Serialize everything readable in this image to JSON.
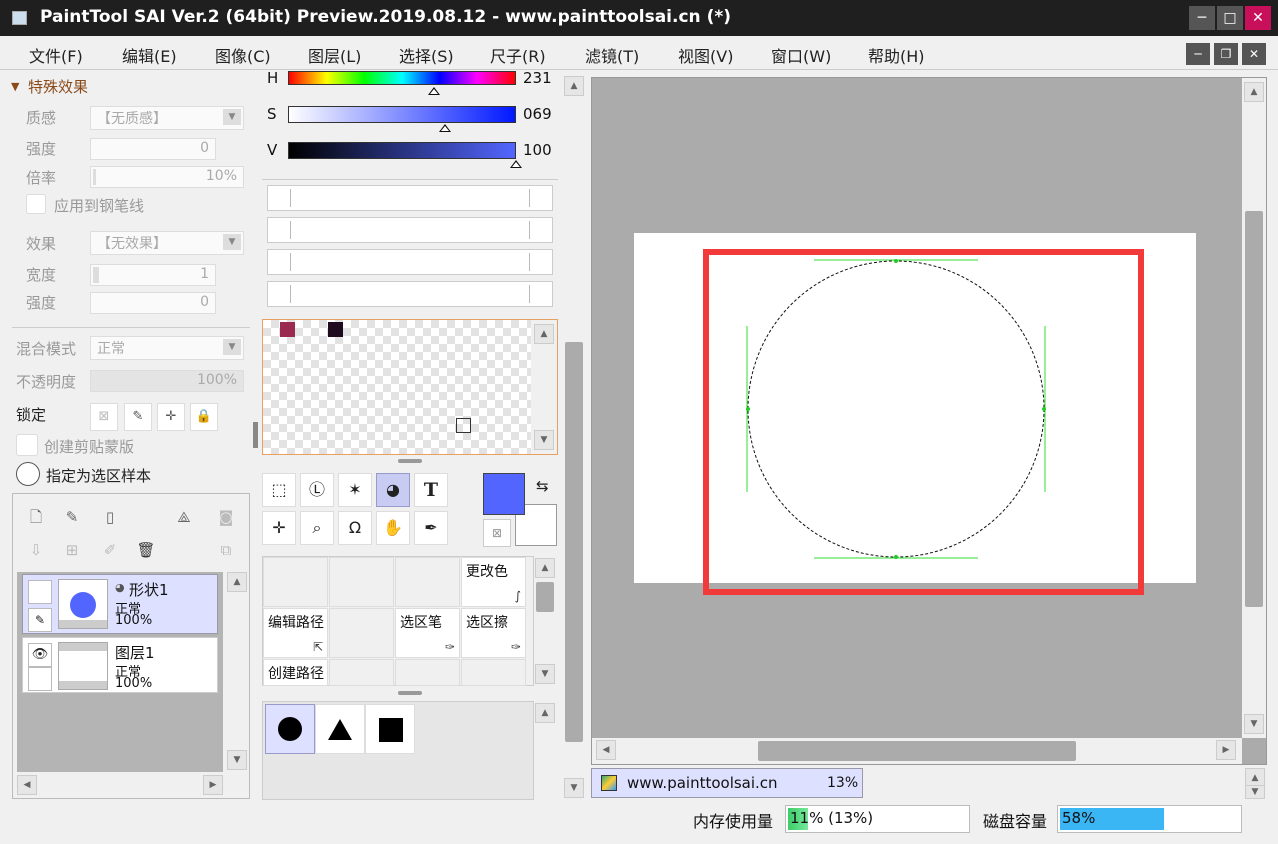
{
  "window": {
    "title": "PaintTool SAI Ver.2 (64bit) Preview.2019.08.12 - www.painttoolsai.cn (*)",
    "min_glyph": "─",
    "max_glyph": "□",
    "close_glyph": "✕",
    "mdi_min_glyph": "─",
    "mdi_restore_glyph": "❐",
    "mdi_close_glyph": "✕"
  },
  "menu": [
    "文件(F)",
    "编辑(E)",
    "图像(C)",
    "图层(L)",
    "选择(S)",
    "尺子(R)",
    "滤镜(T)",
    "视图(V)",
    "窗口(W)",
    "帮助(H)"
  ],
  "effects": {
    "section_title": "特殊效果",
    "texture_label": "质感",
    "texture_value": "【无质感】",
    "strength_label": "强度",
    "strength_value": "0",
    "scale_label": "倍率",
    "scale_value": "10%",
    "apply_pen_label": "应用到钢笔线",
    "effect_label": "效果",
    "effect_value": "【无效果】",
    "width_label": "宽度",
    "width_value": "1",
    "strength2_label": "强度",
    "strength2_value": "0"
  },
  "layer_props": {
    "blend_label": "混合模式",
    "blend_value": "正常",
    "opacity_label": "不透明度",
    "opacity_value": "100%",
    "lock_label": "锁定",
    "clip_label": "创建剪贴蒙版",
    "sample_label": "指定为选区样本"
  },
  "layers": [
    {
      "name": "形状1",
      "mode": "正常",
      "opacity": "100%",
      "selected": true
    },
    {
      "name": "图层1",
      "mode": "正常",
      "opacity": "100%",
      "selected": false
    }
  ],
  "color": {
    "h_label": "H",
    "h_value": "231",
    "h_level": 0.64,
    "s_label": "S",
    "s_value": "069",
    "s_level": 0.69,
    "v_label": "V",
    "v_value": "100",
    "v_level": 1.0,
    "foreground": "#5266ff",
    "background": "#ffffff",
    "swatches": [
      "#9a2a4f",
      "#200a1e"
    ]
  },
  "tools": [
    "rect-select",
    "lasso",
    "magic-wand",
    "shape",
    "text",
    "move",
    "zoom",
    "rotate",
    "hand",
    "eyedropper"
  ],
  "tool_glyphs": {
    "rect": "⬚",
    "lasso": "Ⓛ",
    "wand": "✶",
    "shape": "◕",
    "text": "T",
    "move": "✛",
    "zoom": "⌕",
    "rotate": "Ω",
    "hand": "✋",
    "dropper": "✒"
  },
  "tool_grid": {
    "change_color": "更改色",
    "edit_path": "编辑路径",
    "select_pen": "选区笔",
    "select_erase": "选区擦",
    "create_path": "创建路径"
  },
  "document": {
    "name": "www.painttoolsai.cn",
    "zoom": "13%"
  },
  "status": {
    "memory_label": "内存使用量",
    "memory_value": "11% (13%)",
    "memory_level": 0.11,
    "disk_label": "磁盘容量",
    "disk_value": "58%",
    "disk_level": 0.58
  }
}
